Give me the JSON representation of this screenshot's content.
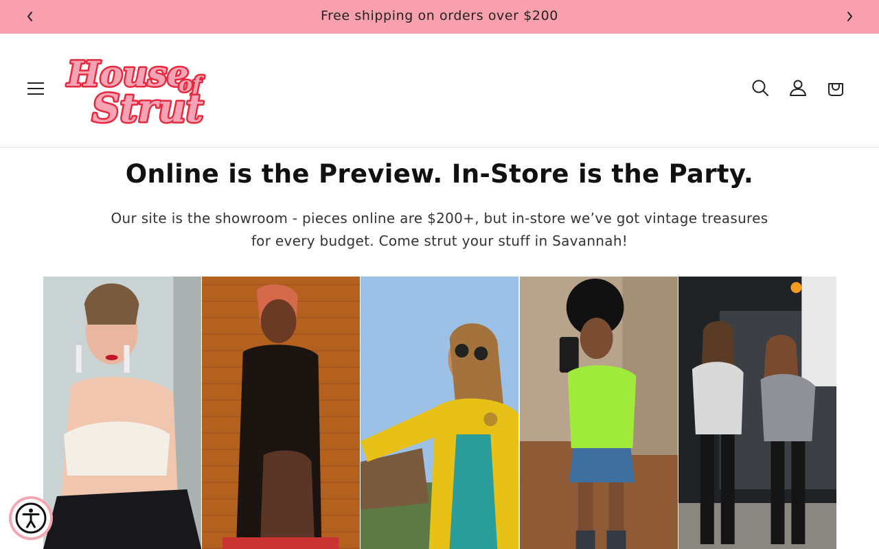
{
  "announcement": {
    "text": "Free shipping on orders over $200",
    "prev_icon": "chevron-left-icon",
    "next_icon": "chevron-right-icon",
    "background": "#f8a0ad"
  },
  "header": {
    "logo_alt": "House of Strut",
    "logo_colors": {
      "fill": "#f5a3b5",
      "outline": "#e8283c"
    },
    "icons": [
      "menu-icon",
      "search-icon",
      "account-icon",
      "cart-icon"
    ]
  },
  "hero": {
    "title": "Online is the Preview. In-Store is the Party.",
    "subtitle": "Our site is the showroom - pieces online are $200+, but in-store we’ve got vintage treasures for every budget. Come strut your stuff in Savannah!"
  },
  "gallery": {
    "photos": [
      {
        "name": "model-white-bustier",
        "alt": "Woman in white strapless bustier and black skirt"
      },
      {
        "name": "model-black-jacket",
        "alt": "Model in black jacket against orange wood wall"
      },
      {
        "name": "model-yellow-jacket",
        "alt": "Woman in sunglasses and yellow jacket outdoors"
      },
      {
        "name": "model-green-top",
        "alt": "Woman in lime green top and denim skirt taking selfie"
      },
      {
        "name": "models-bobcat",
        "alt": "Two women posing in front of a Bobcat machine"
      }
    ]
  },
  "accessibility": {
    "icon": "accessibility-icon",
    "label": "Accessibility"
  }
}
